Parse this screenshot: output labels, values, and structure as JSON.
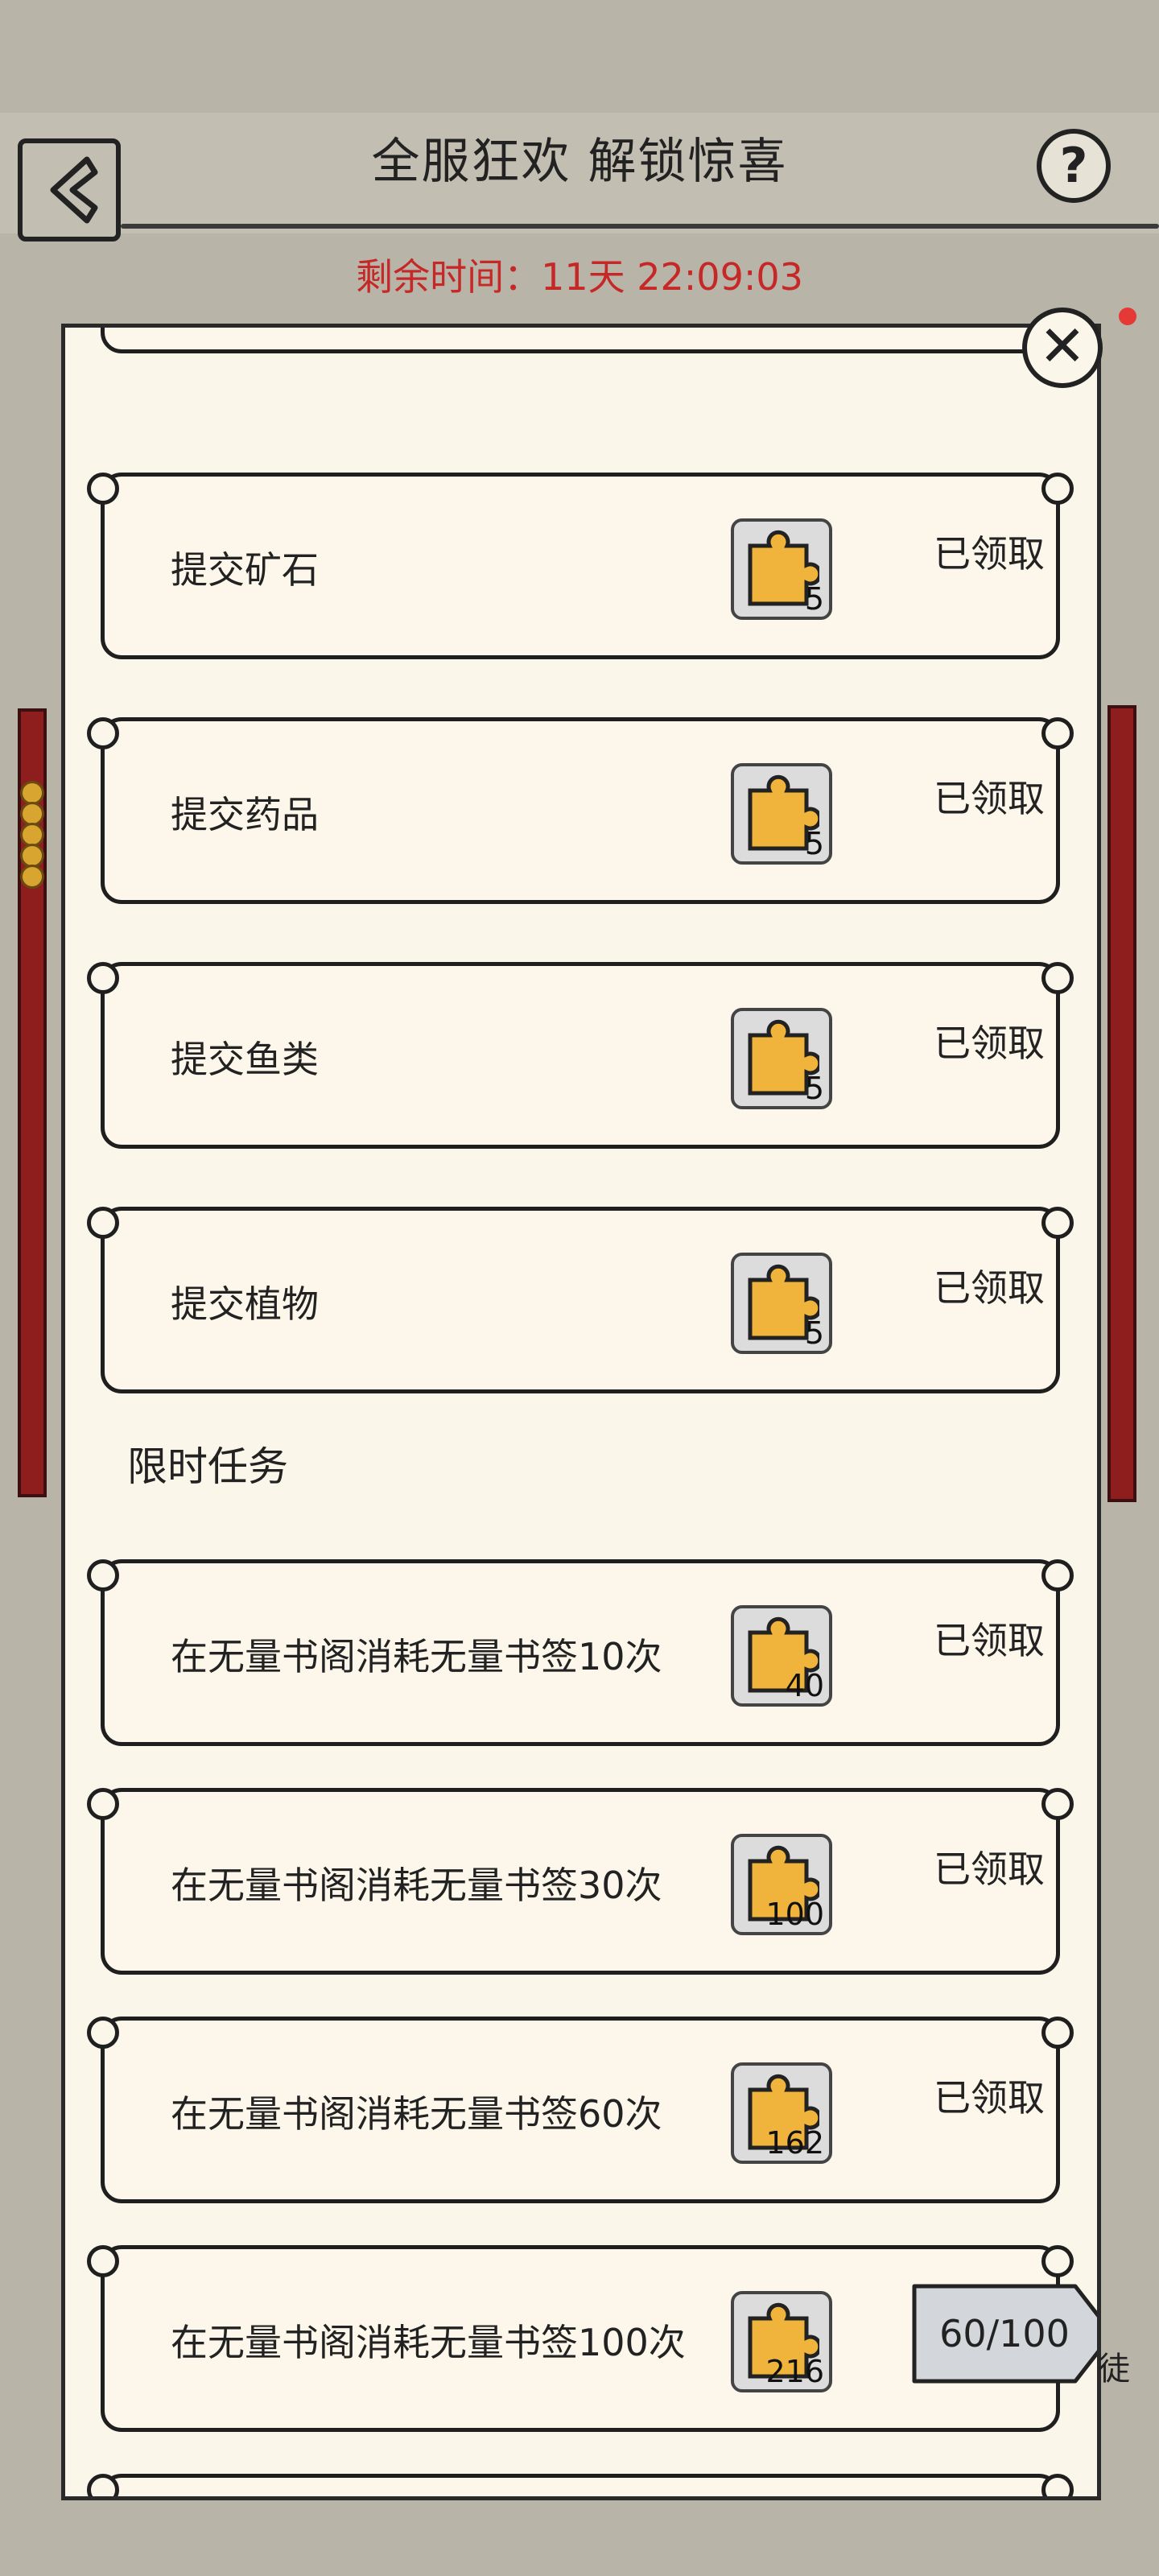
{
  "header": {
    "title": "全服狂欢 解锁惊喜",
    "countdown": "剩余时间：11天 22:09:03",
    "help_symbol": "?",
    "close_symbol": "✕"
  },
  "icons": {
    "back": "back-arrow-icon",
    "help": "question-icon",
    "close": "close-icon",
    "reward": "puzzle-piece-icon"
  },
  "colors": {
    "countdown": "#c62828",
    "reward_tile": "#f0b43c",
    "panel": "#fbf6ea",
    "pole": "#8e1d1d"
  },
  "tasks_top": [
    {
      "name": "提交矿石",
      "reward_qty": "5",
      "status": "已领取"
    },
    {
      "name": "提交药品",
      "reward_qty": "5",
      "status": "已领取"
    },
    {
      "name": "提交鱼类",
      "reward_qty": "5",
      "status": "已领取"
    },
    {
      "name": "提交植物",
      "reward_qty": "5",
      "status": "已领取"
    }
  ],
  "limited_section_title": "限时任务",
  "tasks_limited": [
    {
      "name": "在无量书阁消耗无量书签10次",
      "reward_qty": "40",
      "status": "已领取"
    },
    {
      "name": "在无量书阁消耗无量书签30次",
      "reward_qty": "100",
      "status": "已领取"
    },
    {
      "name": "在无量书阁消耗无量书签60次",
      "reward_qty": "162",
      "status": "已领取"
    },
    {
      "name": "在无量书阁消耗无量书签100次",
      "reward_qty": "216",
      "progress": "60/100"
    }
  ],
  "edge_text": "徒"
}
